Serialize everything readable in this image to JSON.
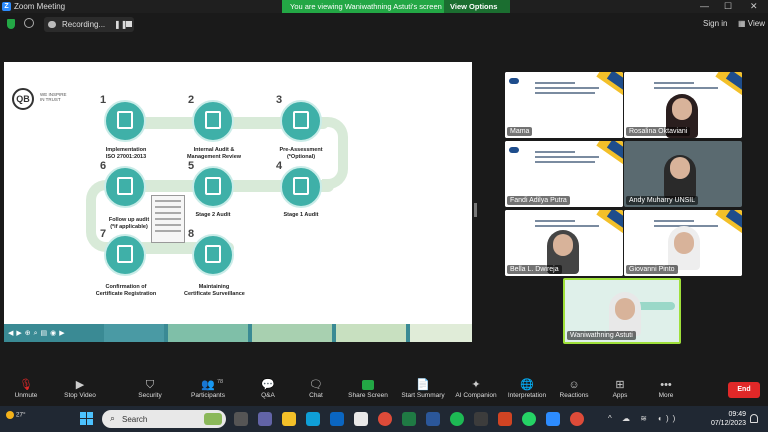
{
  "window": {
    "title": "Zoom Meeting",
    "banner": "You are viewing Waniwathning Astuti's screen",
    "view_options": "View Options"
  },
  "top": {
    "recording": "Recording...",
    "sign_in": "Sign in",
    "view": "View"
  },
  "slide": {
    "logo_text": "WE INSPIRE IN TRUST",
    "steps": [
      {
        "num": "1",
        "label": "Implementation\nISO 27001:2013"
      },
      {
        "num": "2",
        "label": "Internal Audit &\nManagement Review"
      },
      {
        "num": "3",
        "label": "Pre-Assessment\n(*Optional)"
      },
      {
        "num": "4",
        "label": "Stage 1 Audit"
      },
      {
        "num": "5",
        "label": "Stage 2 Audit"
      },
      {
        "num": "6",
        "label": "Follow up audit\n(*if applicable)"
      },
      {
        "num": "7",
        "label": "Confirmation of\nCertificate Registration"
      },
      {
        "num": "8",
        "label": "Maintaining\nCertificate Surveillance"
      }
    ]
  },
  "participants": [
    {
      "name": "Mama"
    },
    {
      "name": "Rosalina Oktaviani"
    },
    {
      "name": "Fandi Adilya Putra"
    },
    {
      "name": "Andy Muharry UNSIL"
    },
    {
      "name": "Bella L. Dwireja"
    },
    {
      "name": "Giovanni Pinto"
    },
    {
      "name": "Waniwathning Astuti"
    }
  ],
  "toolbar": {
    "unmute": "Unmute",
    "stop_video": "Stop Video",
    "security": "Security",
    "participants": "Participants",
    "participants_count": "78",
    "qa": "Q&A",
    "chat": "Chat",
    "share_screen": "Share Screen",
    "start_summary": "Start Summary",
    "ai_companion": "AI Companion",
    "interpretation": "Interpretation",
    "reactions": "Reactions",
    "apps": "Apps",
    "more": "More",
    "end": "End"
  },
  "taskbar": {
    "temp": "27°",
    "search": "Search",
    "time": "09:49",
    "date": "07/12/2023"
  },
  "colors": {
    "accent_green": "#23a745",
    "teal": "#3fb0a8",
    "end_red": "#e02828"
  }
}
